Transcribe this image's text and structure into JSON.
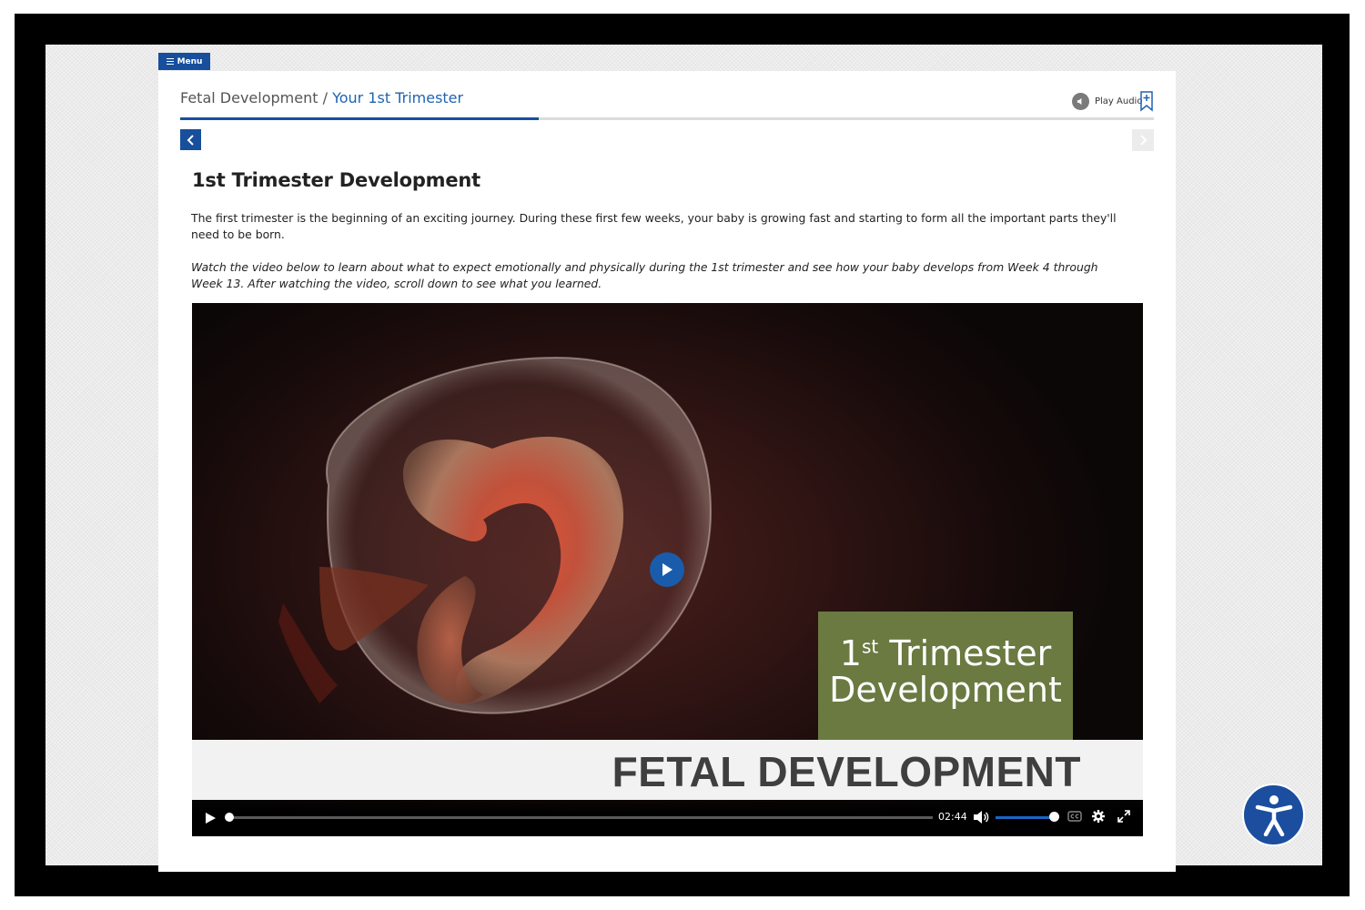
{
  "menu": {
    "label": "Menu"
  },
  "breadcrumb": {
    "parent": "Fetal Development",
    "separator": "/",
    "current": "Your 1st Trimester"
  },
  "progress": {
    "fraction": 0.368
  },
  "audio": {
    "label": "Play Audio"
  },
  "page": {
    "title": "1st Trimester Development",
    "intro": "The first trimester is the beginning of an exciting journey. During these first few weeks, your baby is growing fast and starting to form all the important parts they'll need to be born.",
    "instructions": "Watch the video below to learn about what to expect emotionally and physically during the 1st trimester and see how your baby develops from Week 4 through Week 13. After watching the video, scroll down to see what you learned."
  },
  "video": {
    "overlay_line1_main": "1",
    "overlay_line1_sup": "st",
    "overlay_line1_rest": " Trimester",
    "overlay_line2": "Development",
    "banner": "FETAL DEVELOPMENT",
    "time": "02:44",
    "seek_fraction": 0.0,
    "volume_fraction": 1.0
  },
  "icons": [
    "menu-icon",
    "play-audio-icon",
    "bookmark-add-icon",
    "chevron-left-icon",
    "chevron-right-icon",
    "play-icon",
    "volume-icon",
    "closed-captions-icon",
    "settings-gear-icon",
    "fullscreen-icon",
    "accessibility-icon"
  ],
  "colors": {
    "brand_blue": "#174f9c",
    "link_blue": "#1f63b3",
    "overlay_green": "#6a7a41"
  }
}
